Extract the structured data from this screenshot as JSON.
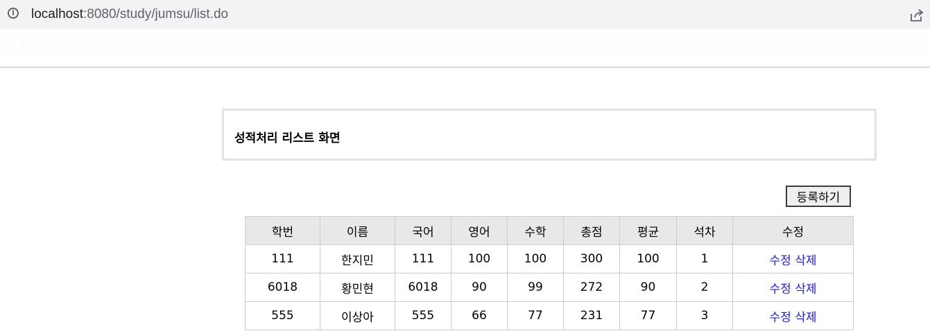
{
  "browser": {
    "url_host": "localhost",
    "url_path": ":8080/study/jumsu/list.do"
  },
  "page": {
    "title": "성적처리 리스트 화면",
    "register_label": "등록하기"
  },
  "table": {
    "headers": [
      "학번",
      "이름",
      "국어",
      "영어",
      "수학",
      "총점",
      "평균",
      "석차",
      "수정"
    ],
    "rows": [
      {
        "id": "111",
        "name": "한지민",
        "kor": "111",
        "eng": "100",
        "math": "100",
        "total": "300",
        "avg": "100",
        "rank": "1",
        "edit": "수정",
        "delete": "삭제"
      },
      {
        "id": "6018",
        "name": "황민현",
        "kor": "6018",
        "eng": "90",
        "math": "99",
        "total": "272",
        "avg": "90",
        "rank": "2",
        "edit": "수정",
        "delete": "삭제"
      },
      {
        "id": "555",
        "name": "이상아",
        "kor": "555",
        "eng": "66",
        "math": "77",
        "total": "231",
        "avg": "77",
        "rank": "3",
        "edit": "수정",
        "delete": "삭제"
      }
    ]
  },
  "colors": {
    "link": "#1a1aff",
    "header_bg": "#e8e8e8",
    "border": "#cccccc"
  },
  "icons": [
    "info-icon",
    "share-icon"
  ]
}
